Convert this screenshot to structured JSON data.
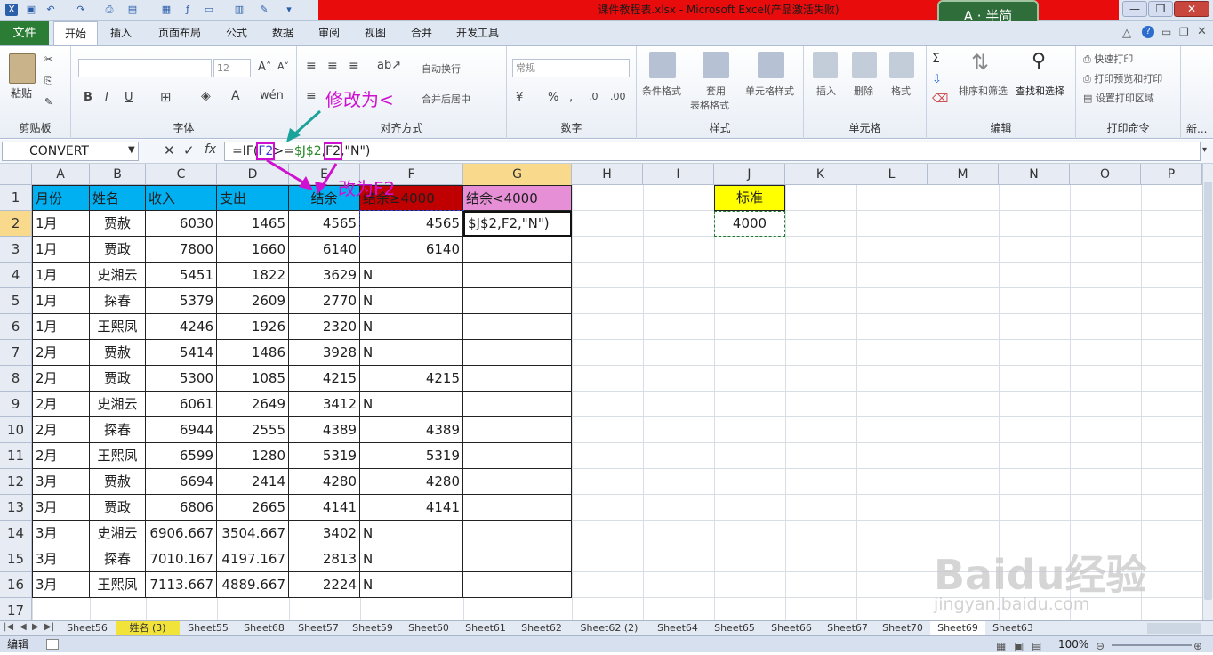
{
  "window": {
    "title": "课件教程表.xlsx - Microsoft Excel(产品激活失败)",
    "logo_text": "A · 半简"
  },
  "menu": {
    "file": "文件",
    "tabs": [
      "开始",
      "插入",
      "页面布局",
      "公式",
      "数据",
      "审阅",
      "视图",
      "合并",
      "开发工具"
    ]
  },
  "ribbon": {
    "clipboard": {
      "paste": "粘贴",
      "label": "剪贴板"
    },
    "font": {
      "size": "12",
      "label": "字体"
    },
    "align": {
      "wrap": "自动换行",
      "merge": "合并后居中",
      "label": "对齐方式"
    },
    "number": {
      "format": "常规",
      "label": "数字"
    },
    "styles": {
      "cond": "条件格式",
      "table": "套用",
      "table2": "表格格式",
      "cell": "单元格样式",
      "label": "样式"
    },
    "cells": {
      "insert": "插入",
      "delete": "删除",
      "format": "格式",
      "label": "单元格"
    },
    "edit": {
      "sort": "排序和筛选",
      "find": "查找和选择",
      "label": "编辑"
    },
    "print": {
      "quick": "快速打印",
      "preview": "打印预览和打印",
      "area": "设置打印区域",
      "label": "打印命令"
    },
    "new_label": "新..."
  },
  "formula_bar": {
    "name_box": "CONVERT",
    "fx": "fx",
    "formula_parts": [
      "=IF(",
      "F2",
      ">=",
      "$J$2",
      ",",
      "F2",
      ",\"N\")"
    ]
  },
  "annotations": {
    "top": "修改为<",
    "side": "改为F2"
  },
  "columns": [
    "A",
    "B",
    "C",
    "D",
    "E",
    "F",
    "G",
    "H",
    "I",
    "J",
    "K",
    "L",
    "M",
    "N",
    "O",
    "P"
  ],
  "row_numbers": [
    "1",
    "2",
    "3",
    "4",
    "5",
    "6",
    "7",
    "8",
    "9",
    "10",
    "11",
    "12",
    "13",
    "14",
    "15",
    "16",
    "17"
  ],
  "table": {
    "headers": [
      "月份",
      "姓名",
      "收入",
      "支出",
      "结余",
      "结余≥4000",
      "结余<4000"
    ],
    "rows": [
      [
        "1月",
        "贾赦",
        "6030",
        "1465",
        "4565",
        "4565",
        "$J$2,F2,\"N\")"
      ],
      [
        "1月",
        "贾政",
        "7800",
        "1660",
        "6140",
        "6140",
        ""
      ],
      [
        "1月",
        "史湘云",
        "5451",
        "1822",
        "3629",
        "N",
        ""
      ],
      [
        "1月",
        "探春",
        "5379",
        "2609",
        "2770",
        "N",
        ""
      ],
      [
        "1月",
        "王熙凤",
        "4246",
        "1926",
        "2320",
        "N",
        ""
      ],
      [
        "2月",
        "贾赦",
        "5414",
        "1486",
        "3928",
        "N",
        ""
      ],
      [
        "2月",
        "贾政",
        "5300",
        "1085",
        "4215",
        "4215",
        ""
      ],
      [
        "2月",
        "史湘云",
        "6061",
        "2649",
        "3412",
        "N",
        ""
      ],
      [
        "2月",
        "探春",
        "6944",
        "2555",
        "4389",
        "4389",
        ""
      ],
      [
        "2月",
        "王熙凤",
        "6599",
        "1280",
        "5319",
        "5319",
        ""
      ],
      [
        "3月",
        "贾赦",
        "6694",
        "2414",
        "4280",
        "4280",
        ""
      ],
      [
        "3月",
        "贾政",
        "6806",
        "2665",
        "4141",
        "4141",
        ""
      ],
      [
        "3月",
        "史湘云",
        "6906.667",
        "3504.667",
        "3402",
        "N",
        ""
      ],
      [
        "3月",
        "探春",
        "7010.167",
        "4197.167",
        "2813",
        "N",
        ""
      ],
      [
        "3月",
        "王熙凤",
        "7113.667",
        "4889.667",
        "2224",
        "N",
        ""
      ]
    ]
  },
  "standard": {
    "label": "标准",
    "value": "4000"
  },
  "sheets": [
    "Sheet56",
    "姓名 (3)",
    "Sheet55",
    "Sheet68",
    "Sheet57",
    "Sheet59",
    "Sheet60",
    "Sheet61",
    "Sheet62",
    "Sheet62 (2)",
    "Sheet64",
    "Sheet65",
    "Sheet66",
    "Sheet67",
    "Sheet70",
    "Sheet69",
    "Sheet63"
  ],
  "status": {
    "mode": "编辑",
    "zoom": "100%"
  },
  "watermark": {
    "brand": "Baidu经验",
    "url": "jingyan.baidu.com"
  },
  "colors": {
    "header_blue": "#00b0f0",
    "header_red": "#c00000",
    "header_pink": "#e68fd6",
    "standard_yellow": "#ffff00",
    "annotation": "#d010d0",
    "excel_green": "#2b7c34"
  }
}
